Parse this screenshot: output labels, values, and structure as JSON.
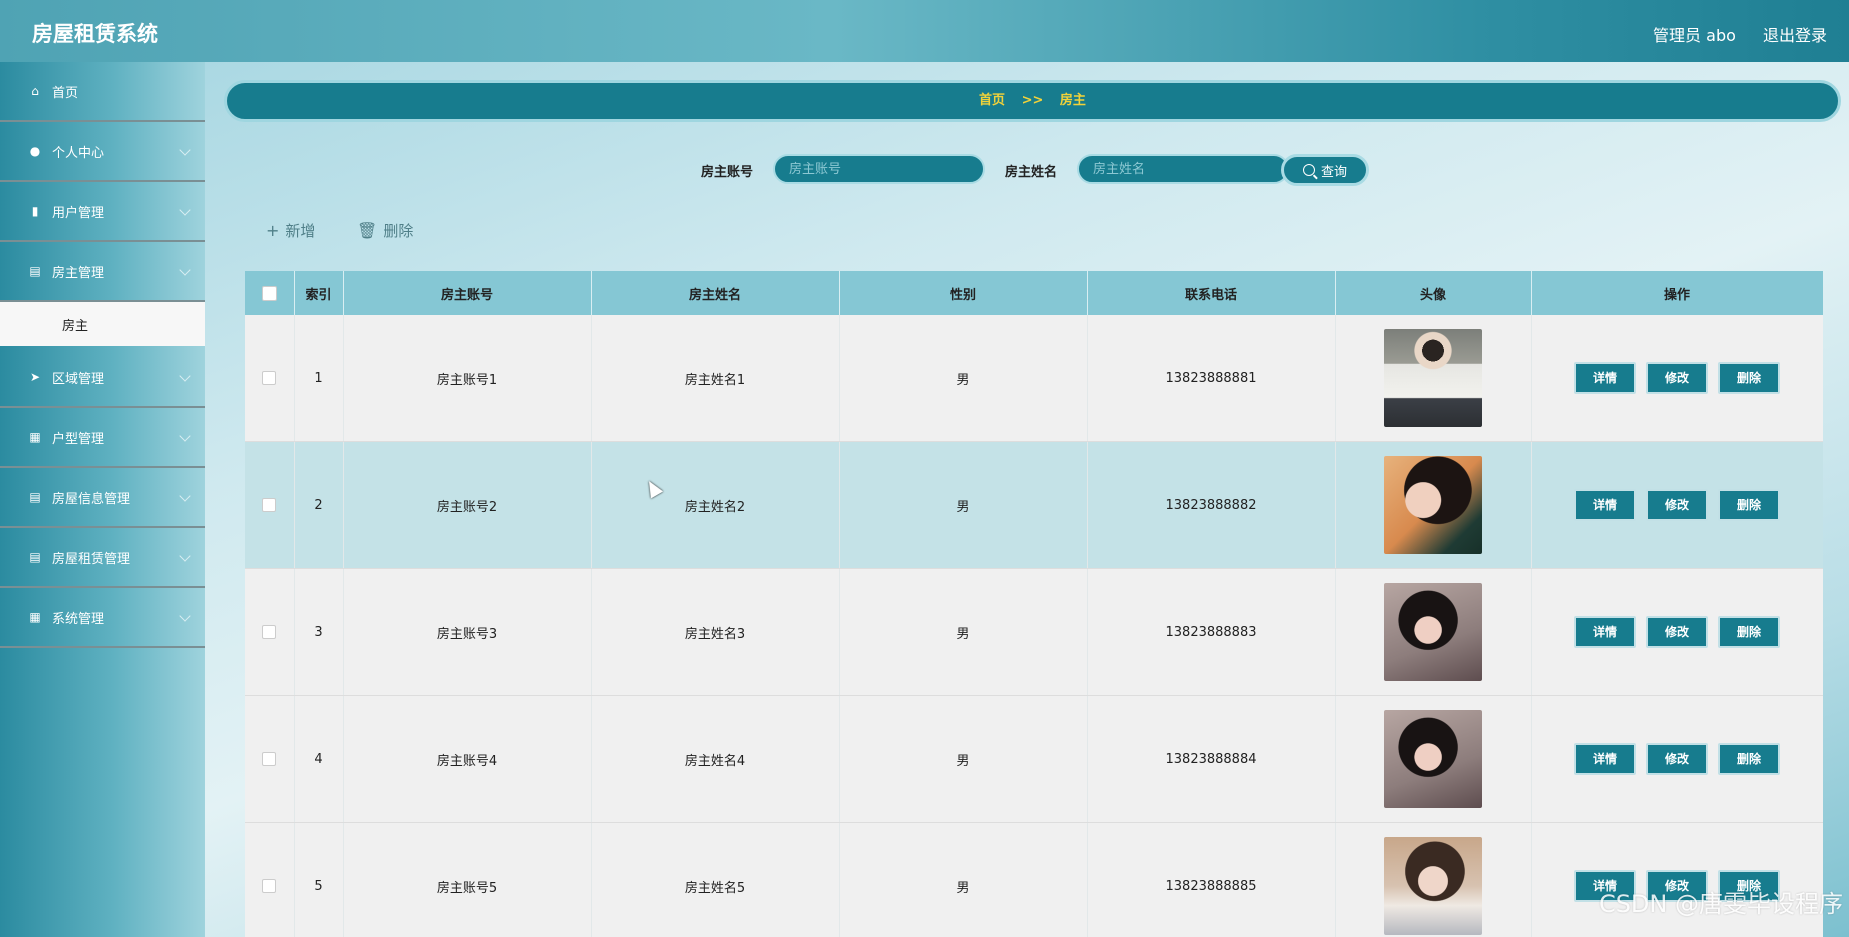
{
  "app": {
    "title": "房屋租赁系统"
  },
  "header": {
    "user": "管理员 abo",
    "logout": "退出登录"
  },
  "sidebar": {
    "items": [
      {
        "label": "首页",
        "icon": "home-icon",
        "expandable": false
      },
      {
        "label": "个人中心",
        "icon": "user-icon",
        "expandable": true
      },
      {
        "label": "用户管理",
        "icon": "bar-chart-icon",
        "expandable": true
      },
      {
        "label": "房主管理",
        "icon": "clipboard-icon",
        "expandable": true,
        "sub": [
          {
            "label": "房主"
          }
        ]
      },
      {
        "label": "区域管理",
        "icon": "send-icon",
        "expandable": true
      },
      {
        "label": "户型管理",
        "icon": "grid-icon",
        "expandable": true
      },
      {
        "label": "房屋信息管理",
        "icon": "clipboard-icon",
        "expandable": true
      },
      {
        "label": "房屋租赁管理",
        "icon": "clipboard-icon",
        "expandable": true
      },
      {
        "label": "系统管理",
        "icon": "grid-icon",
        "expandable": true
      }
    ]
  },
  "breadcrumb": {
    "home": "首页",
    "separator": ">>",
    "current": "房主"
  },
  "search": {
    "account_label": "房主账号",
    "account_placeholder": "房主账号",
    "account_value": "",
    "name_label": "房主姓名",
    "name_placeholder": "房主姓名",
    "name_value": "",
    "button": "查询"
  },
  "toolbar": {
    "add": "新增",
    "delete": "删除"
  },
  "table": {
    "columns": [
      "",
      "索引",
      "房主账号",
      "房主姓名",
      "性别",
      "联系电话",
      "头像",
      "操作"
    ],
    "rows": [
      {
        "index": "1",
        "account": "房主账号1",
        "name": "房主姓名1",
        "gender": "男",
        "phone": "13823888881",
        "avatar": "av1"
      },
      {
        "index": "2",
        "account": "房主账号2",
        "name": "房主姓名2",
        "gender": "男",
        "phone": "13823888882",
        "avatar": "av2"
      },
      {
        "index": "3",
        "account": "房主账号3",
        "name": "房主姓名3",
        "gender": "男",
        "phone": "13823888883",
        "avatar": "av3"
      },
      {
        "index": "4",
        "account": "房主账号4",
        "name": "房主姓名4",
        "gender": "男",
        "phone": "13823888884",
        "avatar": "av3"
      },
      {
        "index": "5",
        "account": "房主账号5",
        "name": "房主姓名5",
        "gender": "男",
        "phone": "13823888885",
        "avatar": "av4"
      }
    ],
    "actions": {
      "detail": "详情",
      "edit": "修改",
      "delete": "删除"
    }
  },
  "watermark": "CSDN @唐雯毕设程序",
  "colors": {
    "primary": "#177c8e",
    "breadcrumb_text": "#f1d23a",
    "header_row": "#85c7d4",
    "alt_row": "#c4e2e7"
  }
}
